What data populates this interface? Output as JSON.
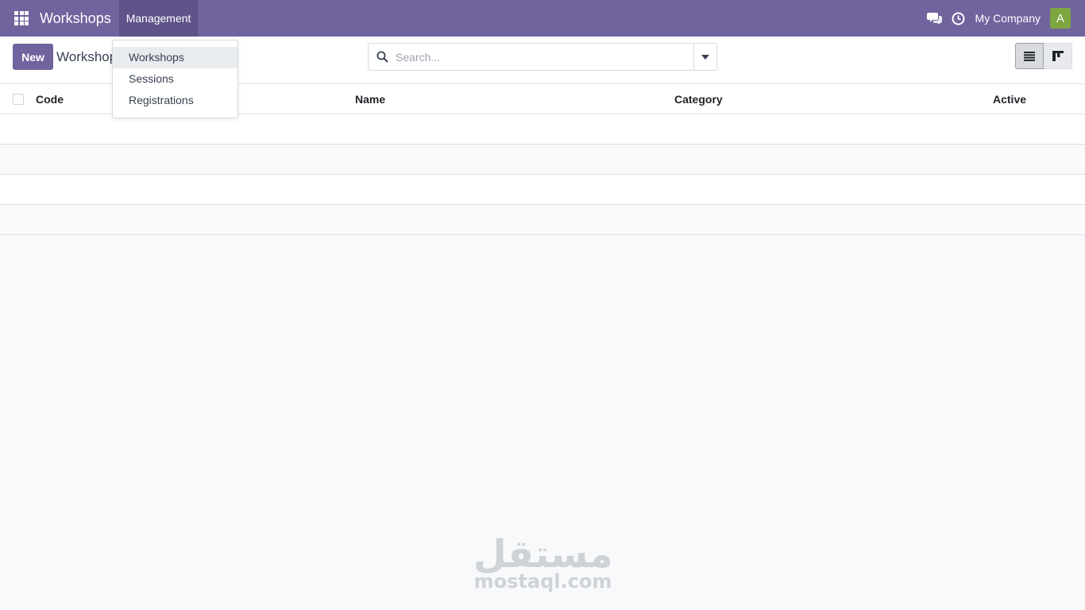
{
  "navbar": {
    "brand": "Workshops",
    "menu_label": "Management",
    "company": "My Company",
    "avatar_letter": "A"
  },
  "control_panel": {
    "new_label": "New",
    "title": "Workshop"
  },
  "search": {
    "placeholder": "Search..."
  },
  "dropdown": {
    "items": [
      {
        "label": "Workshops"
      },
      {
        "label": "Sessions"
      },
      {
        "label": "Registrations"
      }
    ]
  },
  "list": {
    "columns": [
      {
        "label": "Code"
      },
      {
        "label": "Name"
      },
      {
        "label": "Category"
      },
      {
        "label": "Active"
      }
    ]
  },
  "watermark": {
    "arabic": "مستقل",
    "latin": "mostaql.com"
  },
  "colors": {
    "brand": "#71639e",
    "avatar": "#7ea640"
  }
}
